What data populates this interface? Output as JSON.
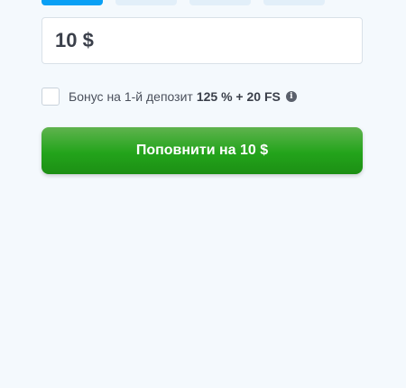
{
  "tabs": [
    {
      "active": true
    },
    {
      "active": false
    },
    {
      "active": false
    },
    {
      "active": false
    }
  ],
  "amount": {
    "value": "10 $"
  },
  "bonus": {
    "checked": false,
    "label": "Бонус на 1-й депозит",
    "value": "125 % + 20 FS",
    "info_icon": "info-icon"
  },
  "submit": {
    "label": "Поповнити на 10 $"
  },
  "colors": {
    "accent": "#0aa0f5",
    "button_green": "#23a41b",
    "background": "#f4f9fd"
  }
}
